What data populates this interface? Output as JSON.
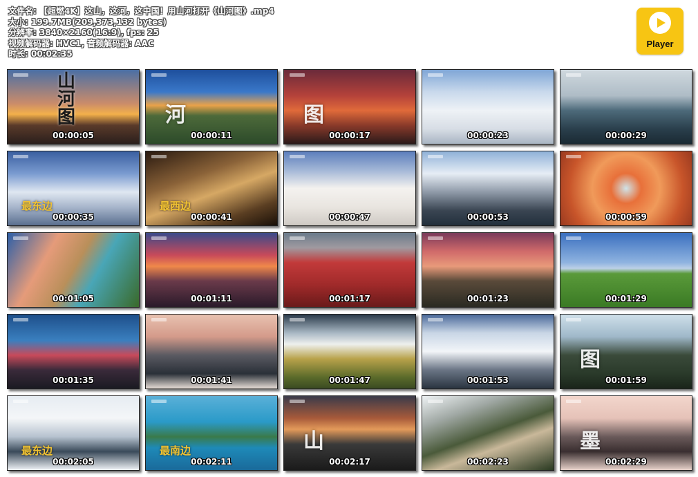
{
  "file_info": {
    "filename": "文件名: 【超燃4K】这山，这河，这中国！用山河打开《山河图》.mp4",
    "size": "大小: 199.7MB(209,373,132 bytes)",
    "resolution": "分辨率: 3840×2160(16:9), fps: 25",
    "codecs": "视频解码器: HVC1, 音频解码器: AAC",
    "duration": "时长: 00:02:35"
  },
  "player_logo": {
    "label": "Player",
    "icon": "play-icon",
    "color": "#f7c513"
  },
  "thumbnails": [
    {
      "time": "00:00:05",
      "overlay": "山河图",
      "overlay_style": "calligraphy"
    },
    {
      "time": "00:00:11",
      "overlay": "河",
      "overlay_style": "big"
    },
    {
      "time": "00:00:17",
      "overlay": "图",
      "overlay_style": "big"
    },
    {
      "time": "00:00:23",
      "overlay": "",
      "overlay_style": ""
    },
    {
      "time": "00:00:29",
      "overlay": "",
      "overlay_style": ""
    },
    {
      "time": "00:00:35",
      "overlay": "最东边",
      "overlay_style": "gold"
    },
    {
      "time": "00:00:41",
      "overlay": "最西边",
      "overlay_style": "gold"
    },
    {
      "time": "00:00:47",
      "overlay": "",
      "overlay_style": ""
    },
    {
      "time": "00:00:53",
      "overlay": "",
      "overlay_style": ""
    },
    {
      "time": "00:00:59",
      "overlay": "",
      "overlay_style": ""
    },
    {
      "time": "00:01:05",
      "overlay": "",
      "overlay_style": ""
    },
    {
      "time": "00:01:11",
      "overlay": "",
      "overlay_style": ""
    },
    {
      "time": "00:01:17",
      "overlay": "",
      "overlay_style": ""
    },
    {
      "time": "00:01:23",
      "overlay": "",
      "overlay_style": ""
    },
    {
      "time": "00:01:29",
      "overlay": "",
      "overlay_style": ""
    },
    {
      "time": "00:01:35",
      "overlay": "",
      "overlay_style": ""
    },
    {
      "time": "00:01:41",
      "overlay": "",
      "overlay_style": ""
    },
    {
      "time": "00:01:47",
      "overlay": "",
      "overlay_style": ""
    },
    {
      "time": "00:01:53",
      "overlay": "",
      "overlay_style": ""
    },
    {
      "time": "00:01:59",
      "overlay": "图",
      "overlay_style": "big"
    },
    {
      "time": "00:02:05",
      "overlay": "最东边",
      "overlay_style": "gold"
    },
    {
      "time": "00:02:11",
      "overlay": "最南边",
      "overlay_style": "gold"
    },
    {
      "time": "00:02:17",
      "overlay": "山",
      "overlay_style": "big"
    },
    {
      "time": "00:02:23",
      "overlay": "",
      "overlay_style": ""
    },
    {
      "time": "00:02:29",
      "overlay": "墨",
      "overlay_style": "big"
    }
  ],
  "thumbnail_scenes": [
    "sunset-mountains",
    "river-meander",
    "red-clouds",
    "snow-mountain",
    "cloudy-valley",
    "frosted-forest",
    "desert-dunes",
    "sea-of-clouds",
    "snowy-peaks",
    "orange-hot-spring",
    "lake-and-temple",
    "city-sunset",
    "red-wetland",
    "river-sunset",
    "grassland",
    "red-mist-lake",
    "pink-cloud-peaks",
    "terraced-fields",
    "snow-ridges",
    "karst-peaks",
    "snowy-river",
    "island-lagoon",
    "dusk-ridge",
    "canyon-river",
    "misty-peaks"
  ]
}
